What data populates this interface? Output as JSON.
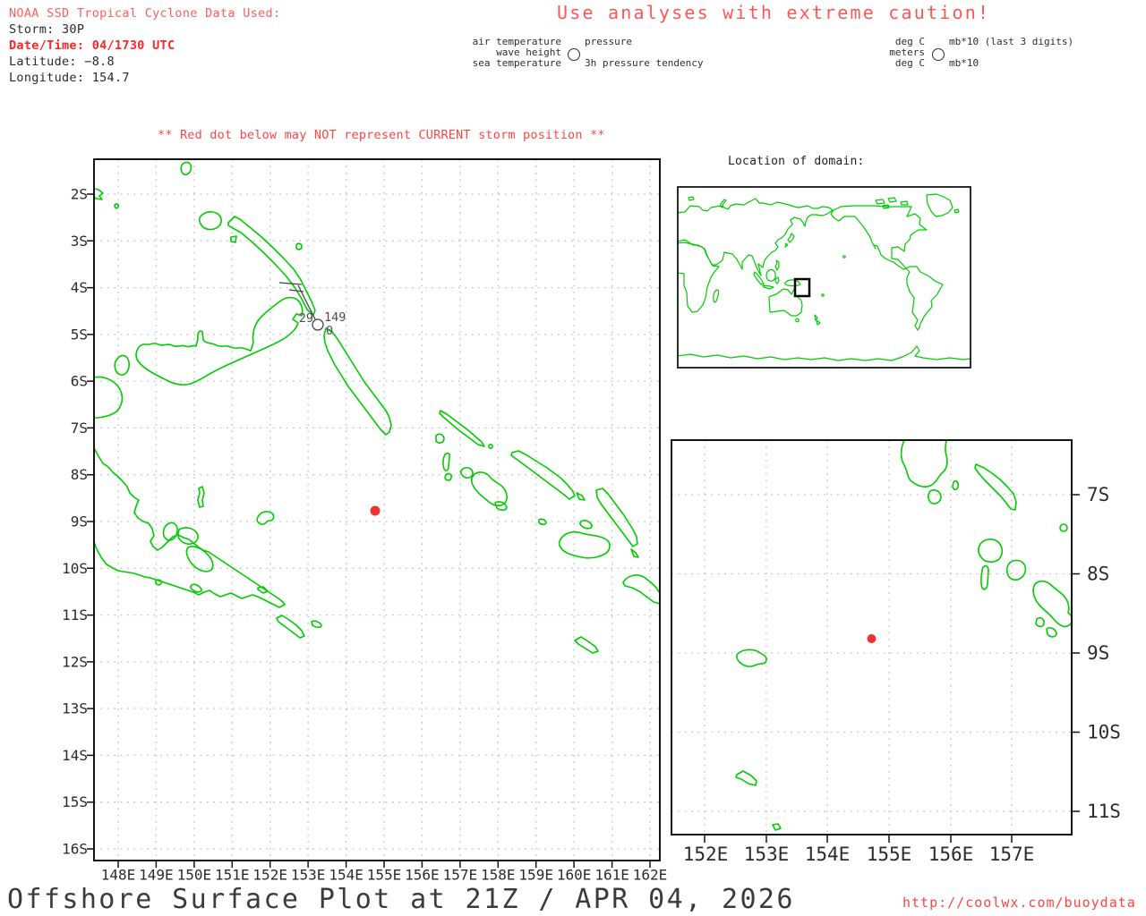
{
  "header": {
    "noaa_title": "NOAA SSD Tropical Cyclone Data Used:",
    "storm": "Storm: 30P",
    "datetime": "Date/Time: 04/1730 UTC",
    "latitude": "Latitude: −8.8",
    "longitude": "Longitude: 154.7",
    "caution": "Use analyses with extreme caution!"
  },
  "legend": {
    "left": {
      "air": "air temperature",
      "wave": "wave height",
      "sea": "sea temperature",
      "pressure": "pressure",
      "tendency": "3h pressure tendency"
    },
    "right": {
      "air_units": "deg C",
      "wave_units": "meters",
      "sea_units": "deg C",
      "pressure_units": "mb*10 (last 3 digits)",
      "tendency_units": "mb*10"
    }
  },
  "warning": "** Red dot below may NOT represent CURRENT storm position **",
  "main_map": {
    "lat_labels": [
      "2S",
      "3S",
      "4S",
      "5S",
      "6S",
      "7S",
      "8S",
      "9S",
      "10S",
      "11S",
      "12S",
      "13S",
      "14S",
      "15S",
      "16S"
    ],
    "lon_labels": [
      "148E",
      "149E",
      "150E",
      "151E",
      "152E",
      "153E",
      "154E",
      "155E",
      "156E",
      "157E",
      "158E",
      "159E",
      "160E",
      "161E",
      "162E"
    ],
    "station": {
      "air_temp": "29",
      "pressure": "149",
      "tendency": "0"
    }
  },
  "inset_map": {
    "title": "Location of domain:"
  },
  "zoom_map": {
    "lat_labels": [
      "7S",
      "8S",
      "9S",
      "10S",
      "11S"
    ],
    "lon_labels": [
      "152E",
      "153E",
      "154E",
      "155E",
      "156E",
      "157E"
    ]
  },
  "footer": {
    "title": "Offshore Surface Plot at 21Z / APR 04, 2026",
    "url": "http://coolwx.com/buoydata"
  },
  "colors": {
    "coast_green": "#00cc00",
    "storm_red": "#ee3333",
    "text_red": "#ff4545"
  }
}
